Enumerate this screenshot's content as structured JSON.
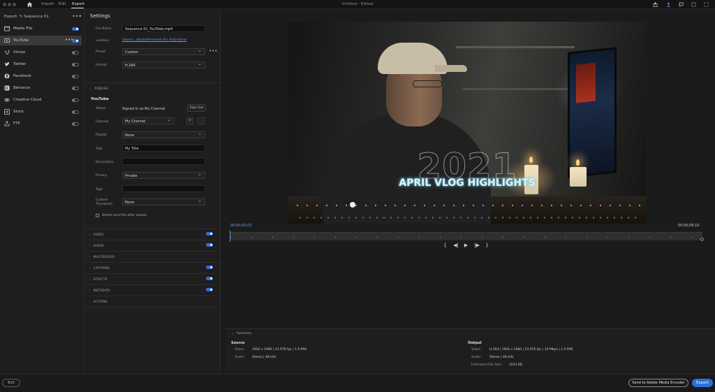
{
  "titlebar": {
    "tabs": {
      "import": "Import",
      "edit": "Edit",
      "export": "Export"
    },
    "doc_title": "Untitled - Edited"
  },
  "sources": {
    "header": "Export:  ✎  Sequence 01",
    "more": "•••",
    "item_more": "•••",
    "items": [
      {
        "label": "Media File",
        "icon": "media-file-icon",
        "on": true
      },
      {
        "label": "YouTube",
        "icon": "youtube-icon",
        "on": true
      },
      {
        "label": "Vimeo",
        "icon": "vimeo-icon",
        "on": false
      },
      {
        "label": "Twitter",
        "icon": "twitter-icon",
        "on": false
      },
      {
        "label": "Facebook",
        "icon": "facebook-icon",
        "on": false
      },
      {
        "label": "Behance",
        "icon": "behance-icon",
        "on": false
      },
      {
        "label": "Creative Cloud",
        "icon": "creative-cloud-icon",
        "on": false
      },
      {
        "label": "Stock",
        "icon": "stock-icon",
        "on": false
      },
      {
        "label": "FTP",
        "icon": "ftp-icon",
        "on": false
      }
    ]
  },
  "settings": {
    "title": "Settings",
    "file_name_label": "File Name",
    "file_name_value": "Sequence 01_YouTube.mp4",
    "location_label": "Location",
    "location_value": "/Users/.../Adobe/Premiere Pro Auto-Save/",
    "preset_label": "Preset",
    "preset_value": "Custom",
    "preset_more": "•••",
    "format_label": "Format",
    "format_value": "H.264",
    "publish_head": "PUBLISH",
    "youtube_head": "YouTube",
    "status_label": "Status",
    "status_value": "Signed in as My Channel",
    "signout_label": "Sign Out",
    "channel_label": "Channel",
    "channel_value": "My Channel",
    "plus": "+",
    "playlist_label": "Playlist",
    "playlist_value": "None",
    "title_label": "Title",
    "title_value": "My Title",
    "description_label": "Description",
    "privacy_label": "Privacy",
    "privacy_value": "Private",
    "tags_label": "Tags",
    "thumb_label_1": "Custom",
    "thumb_label_2": "Thumbnail",
    "thumb_value": "None",
    "delete_label": "Delete local file after upload",
    "sections": [
      {
        "label": "VIDEO",
        "toggle": true
      },
      {
        "label": "AUDIO",
        "toggle": true
      },
      {
        "label": "MULTIPLEXER",
        "toggle": false
      },
      {
        "label": "CAPTIONS",
        "toggle": true
      },
      {
        "label": "EFFECTS",
        "toggle": true
      },
      {
        "label": "METADATA",
        "toggle": true
      },
      {
        "label": "ACTIONS",
        "toggle": false
      }
    ]
  },
  "preview": {
    "year": "2021",
    "headline": "APRIL VLOG HIGHLIGHTS",
    "time_start": "00;00;00;00",
    "time_end": "00;00;06;10",
    "transport": {
      "in": "{",
      "step_back": "◀|",
      "play": "▶",
      "step_fwd": "|▶",
      "out": "}"
    }
  },
  "summary": {
    "head": "Summary",
    "source_head": "Source",
    "output_head": "Output",
    "video_key": "Video:",
    "audio_key": "Audio:",
    "size_key": "Estimated File Size:",
    "source_video": "1920 x 1080  |  23.976 fps  |  1.0 PAR",
    "source_audio": "Stereo  |  48 kHz",
    "output_video": "H.264  |  1920 x 1080  |  23.976 fps  |  16 Mbps  |  1.0 PAR",
    "output_audio": "Stereo  |  48 kHz",
    "output_size": "1631 KB"
  },
  "bottom": {
    "exit": "Exit",
    "ame": "Send to Adobe Media Encoder",
    "export": "Export"
  },
  "colors": {
    "accent": "#2d6fd6",
    "link": "#6a9ee8",
    "panel": "#1e1e1e",
    "bg": "#1b1b1b"
  }
}
